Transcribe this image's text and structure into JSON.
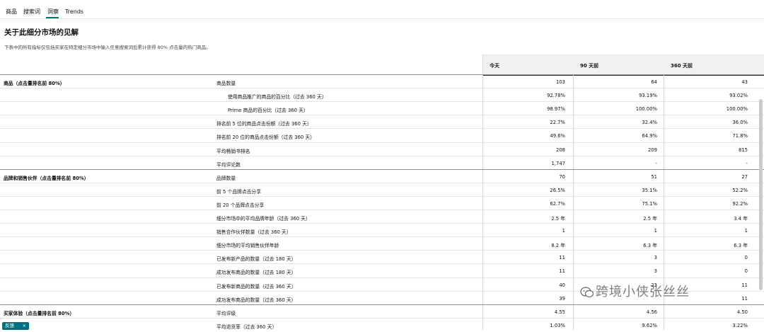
{
  "tabs": [
    {
      "label": "商品"
    },
    {
      "label": "搜索词"
    },
    {
      "label": "洞察"
    },
    {
      "label": "Trends"
    }
  ],
  "title": "关于此细分市场的见解",
  "description": "下表中的所有指标仅包括买家在特定细分市场中输入任意搜索词后累计获得 80% 点击量的热门商品。",
  "columns": [
    "今天",
    "90 天前",
    "360 天前"
  ],
  "rows": [
    {
      "section": "商品（点击量排名前 80%）",
      "metric": "商品数量",
      "indent": false,
      "values": [
        "103",
        "64",
        "43"
      ]
    },
    {
      "section": "",
      "metric": "使用商品推广的商品的百分比（过去 360 天）",
      "indent": true,
      "values": [
        "92.78%",
        "93.19%",
        "93.02%"
      ]
    },
    {
      "section": "",
      "metric": "Prime 商品的百分比（过去 360 天）",
      "indent": true,
      "values": [
        "98.97%",
        "100.00%",
        "100.00%"
      ]
    },
    {
      "section": "",
      "metric": "排名前 5 位的商品点击份额（过去 360 天）",
      "indent": false,
      "values": [
        "22.7%",
        "32.4%",
        "36.0%"
      ]
    },
    {
      "section": "",
      "metric": "排名前 20 位的商品点击份额（过去 360 天）",
      "indent": false,
      "values": [
        "49.6%",
        "64.9%",
        "71.8%"
      ]
    },
    {
      "section": "",
      "metric": "平均畅销书排名",
      "indent": false,
      "values": [
        "208",
        "209",
        "815"
      ]
    },
    {
      "section": "",
      "metric": "平均评论数",
      "indent": false,
      "values": [
        "1,747",
        "-",
        "-"
      ]
    },
    {
      "section": "品牌和销售伙伴（点击量排名前 80%）",
      "metric": "品牌数量",
      "indent": false,
      "values": [
        "70",
        "51",
        "27"
      ]
    },
    {
      "section": "",
      "metric": "前 5 个品牌点击分享",
      "indent": false,
      "values": [
        "26.5%",
        "35.1%",
        "52.2%"
      ]
    },
    {
      "section": "",
      "metric": "前 20 个品牌点击分享",
      "indent": false,
      "values": [
        "62.7%",
        "75.1%",
        "92.2%"
      ]
    },
    {
      "section": "",
      "metric": "细分市场中的平均品牌年龄（过去 360 天）",
      "indent": false,
      "values": [
        "2.5 年",
        "2.5 年",
        "3.4 年"
      ]
    },
    {
      "section": "",
      "metric": "销售合作伙伴数量（过去 360 天）",
      "indent": false,
      "values": [
        "1",
        "1",
        "1"
      ]
    },
    {
      "section": "",
      "metric": "细分市场的平均销售伙伴年龄",
      "indent": false,
      "values": [
        "8.2 年",
        "6.3 年",
        "6.3 年"
      ]
    },
    {
      "section": "",
      "metric": "已发布新产品的数量（过去 180 天）",
      "indent": false,
      "values": [
        "11",
        "3",
        "0"
      ]
    },
    {
      "section": "",
      "metric": "成功发布商品的数量（过去 180 天）",
      "indent": false,
      "values": [
        "11",
        "3",
        "0"
      ]
    },
    {
      "section": "",
      "metric": "已发布新商品的数量（过去 360 天）",
      "indent": false,
      "values": [
        "40",
        "23",
        "11"
      ]
    },
    {
      "section": "",
      "metric": "成功发布商品的数量（过去 360 天）",
      "indent": false,
      "values": [
        "39",
        "",
        "11"
      ]
    },
    {
      "section": "买家体验（点击量排名前 80%）",
      "metric": "平均评级",
      "indent": false,
      "values": [
        "4.55",
        "4.56",
        "4.50"
      ]
    },
    {
      "section": "",
      "metric": "平均退货率（过去 360 天）",
      "indent": false,
      "values": [
        "1.03%",
        "9.62%",
        "3.22%"
      ]
    }
  ],
  "chip": {
    "label": "反馈",
    "close": "×"
  },
  "watermark": "跨境小侠张丝丝"
}
